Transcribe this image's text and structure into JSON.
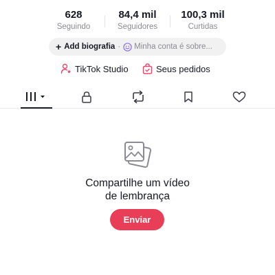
{
  "stats": [
    {
      "value": "628",
      "label": "Seguindo"
    },
    {
      "value": "84,4 mil",
      "label": "Seguidores"
    },
    {
      "value": "100,3 mil",
      "label": "Curtidas"
    }
  ],
  "bio": {
    "plus": "+",
    "add_label": "Add biografia",
    "separator": "·",
    "account_text": "Minha conta é sobre..."
  },
  "links": {
    "studio": "TikTok Studio",
    "orders": "Seus pedidos"
  },
  "tabs": [
    {
      "icon": "videos-grid-icon",
      "active": true
    },
    {
      "icon": "lock-icon",
      "active": false
    },
    {
      "icon": "repost-icon",
      "active": false
    },
    {
      "icon": "bookmark-icon",
      "active": false
    },
    {
      "icon": "heart-icon",
      "active": false
    }
  ],
  "empty_state": {
    "icon": "photos-icon",
    "title_line1": "Compartilhe um vídeo",
    "title_line2": "de lembrança",
    "button_label": "Enviar"
  },
  "colors": {
    "accent": "#e83e58",
    "studio_icon": "#e8486a",
    "orders_icon": "#e8486a",
    "smile_icon": "#8c6ee6",
    "muted_text": "#8a8b91",
    "pill_bg": "#f1f1f2"
  }
}
